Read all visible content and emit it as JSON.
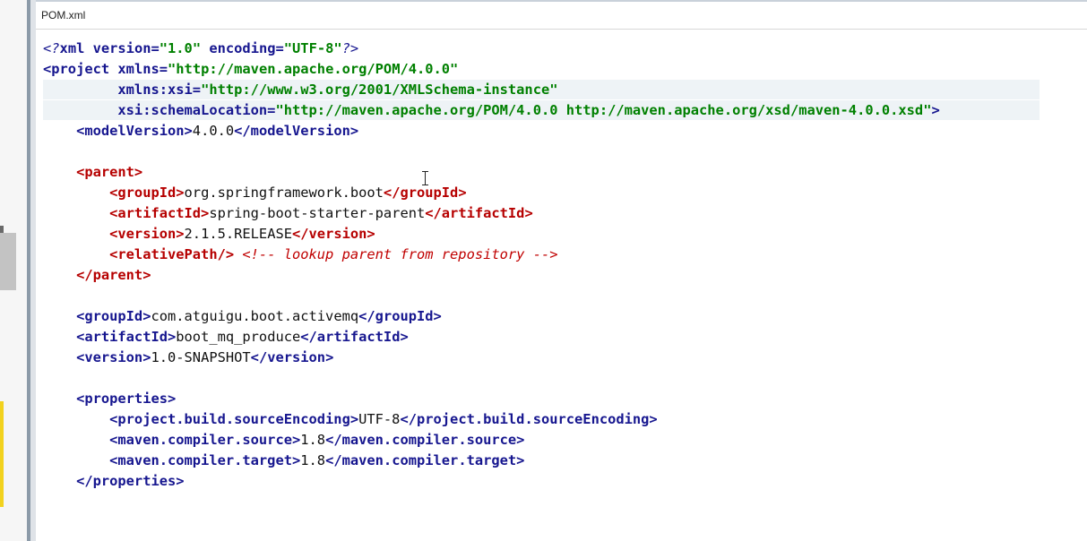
{
  "editor": {
    "tab_title": "POM.xml"
  },
  "code": {
    "lines": [
      [
        {
          "t": "<?",
          "c": "pi"
        },
        {
          "t": "xml version=",
          "c": "tag"
        },
        {
          "t": "\"1.0\"",
          "c": "str"
        },
        {
          "t": " encoding=",
          "c": "tag"
        },
        {
          "t": "\"UTF-8\"",
          "c": "str"
        },
        {
          "t": "?>",
          "c": "pi"
        }
      ],
      [
        {
          "t": "<project",
          "c": "tag"
        },
        {
          "t": " xmlns=",
          "c": "attr"
        },
        {
          "t": "\"http://maven.apache.org/POM/4.0.0\"",
          "c": "str"
        }
      ],
      [
        {
          "t": "         xmlns:xsi=",
          "c": "attr"
        },
        {
          "t": "\"http://www.w3.org/2001/XMLSchema-instance\"",
          "c": "str"
        }
      ],
      [
        {
          "t": "         xsi:schemaLocation=",
          "c": "attr"
        },
        {
          "t": "\"http://maven.apache.org/POM/4.0.0 http://maven.apache.org/xsd/maven-4.0.0.xsd\"",
          "c": "str"
        },
        {
          "t": ">",
          "c": "tag"
        }
      ],
      [
        {
          "t": "    <modelVersion>",
          "c": "tag"
        },
        {
          "t": "4.0.0",
          "c": "text"
        },
        {
          "t": "</modelVersion>",
          "c": "tag"
        }
      ],
      [],
      [
        {
          "t": "    <parent>",
          "c": "tagred"
        }
      ],
      [
        {
          "t": "        <groupId>",
          "c": "tagred"
        },
        {
          "t": "org.springframework.boot",
          "c": "text"
        },
        {
          "t": "</groupId>",
          "c": "tagred"
        }
      ],
      [
        {
          "t": "        <artifactId>",
          "c": "tagred"
        },
        {
          "t": "spring-boot-starter-parent",
          "c": "text"
        },
        {
          "t": "</artifactId>",
          "c": "tagred"
        }
      ],
      [
        {
          "t": "        <version>",
          "c": "tagred"
        },
        {
          "t": "2.1.5.RELEASE",
          "c": "text"
        },
        {
          "t": "</version>",
          "c": "tagred"
        }
      ],
      [
        {
          "t": "        <relativePath/>",
          "c": "tagred"
        },
        {
          "t": " <!-- lookup parent from repository -->",
          "c": "comment"
        }
      ],
      [
        {
          "t": "    </parent>",
          "c": "tagred"
        }
      ],
      [],
      [
        {
          "t": "    <groupId>",
          "c": "tag"
        },
        {
          "t": "com.atguigu.boot.activemq",
          "c": "text"
        },
        {
          "t": "</groupId>",
          "c": "tag"
        }
      ],
      [
        {
          "t": "    <artifactId>",
          "c": "tag"
        },
        {
          "t": "boot_mq_produce",
          "c": "text"
        },
        {
          "t": "</artifactId>",
          "c": "tag"
        }
      ],
      [
        {
          "t": "    <version>",
          "c": "tag"
        },
        {
          "t": "1.0-SNAPSHOT",
          "c": "text"
        },
        {
          "t": "</version>",
          "c": "tag"
        }
      ],
      [],
      [
        {
          "t": "    <properties>",
          "c": "tag"
        }
      ],
      [
        {
          "t": "        <project.build.sourceEncoding>",
          "c": "tag"
        },
        {
          "t": "UTF-8",
          "c": "text"
        },
        {
          "t": "</project.build.sourceEncoding>",
          "c": "tag"
        }
      ],
      [
        {
          "t": "        <maven.compiler.source>",
          "c": "tag"
        },
        {
          "t": "1.8",
          "c": "text"
        },
        {
          "t": "</maven.compiler.source>",
          "c": "tag"
        }
      ],
      [
        {
          "t": "        <maven.compiler.target>",
          "c": "tag"
        },
        {
          "t": "1.8",
          "c": "text"
        },
        {
          "t": "</maven.compiler.target>",
          "c": "tag"
        }
      ],
      [
        {
          "t": "    </properties>",
          "c": "tag"
        }
      ]
    ]
  },
  "colors": {
    "tag_blue": "#16168f",
    "tag_red": "#b60000",
    "string_green": "#008000",
    "comment_red": "#c00000",
    "current_line_bg": "#eef3f6"
  }
}
